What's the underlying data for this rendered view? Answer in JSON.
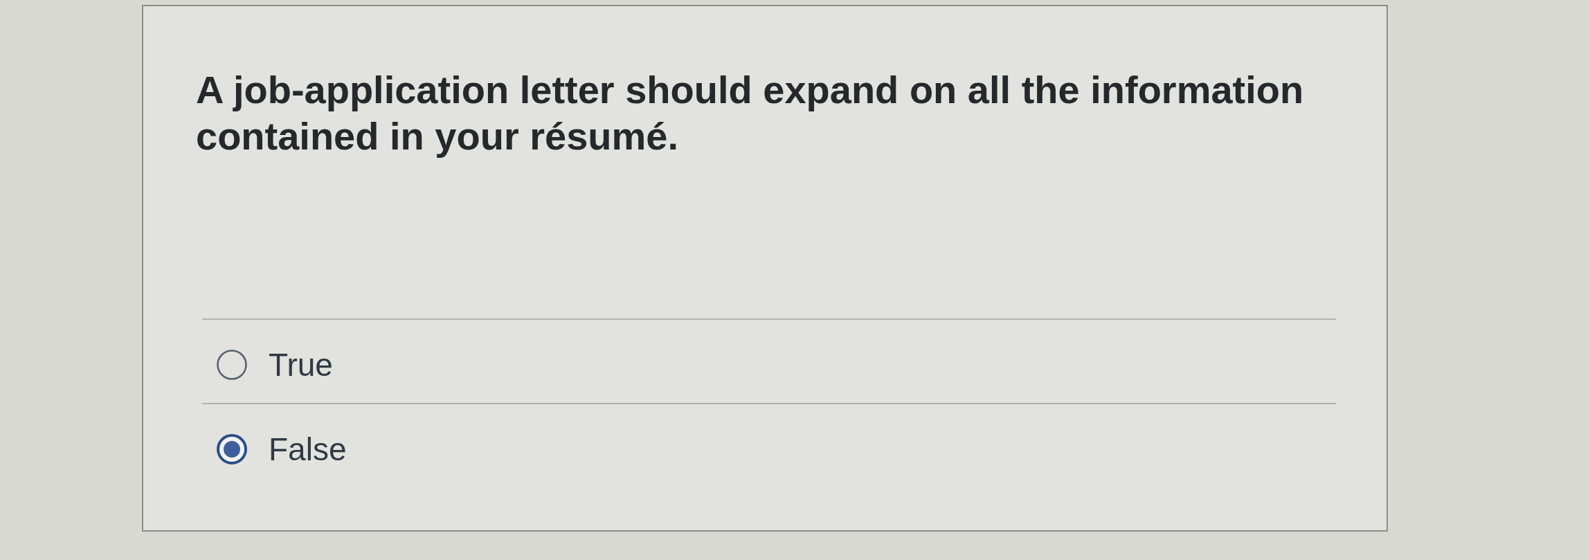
{
  "question": {
    "text": "A job-application letter should expand on all the information contained in your résumé."
  },
  "answers": [
    {
      "label": "True",
      "selected": false
    },
    {
      "label": "False",
      "selected": true
    }
  ]
}
